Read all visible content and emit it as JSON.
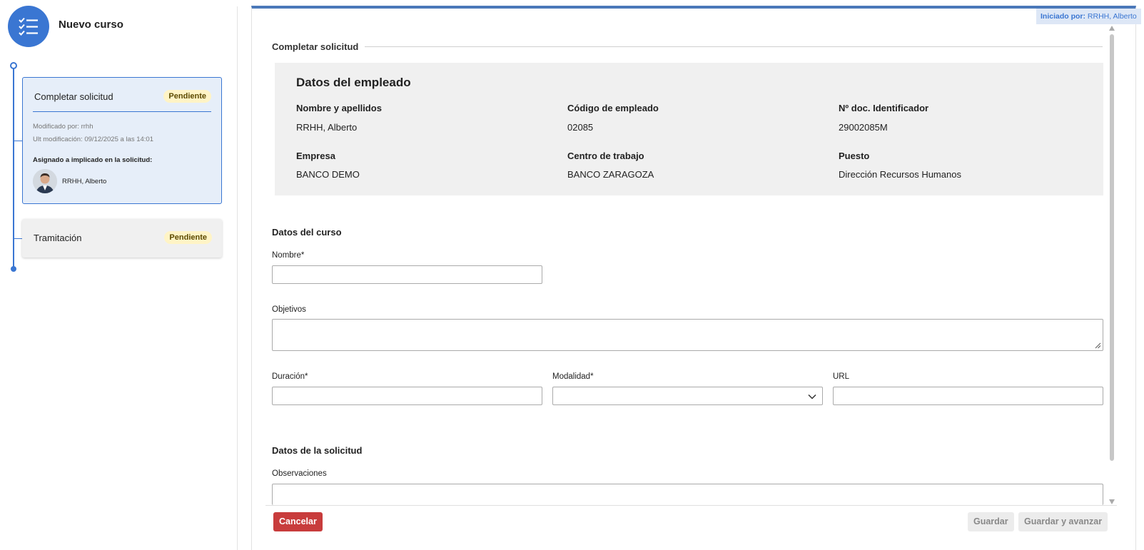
{
  "header": {
    "title": "Nuevo curso",
    "icon": "checklist-icon"
  },
  "steps": [
    {
      "title": "Completar solicitud",
      "status": "Pendiente",
      "modified_by": "Modificado por: rrhh",
      "last_modified": "Ult modificación: 09/12/2025 a las 14:01",
      "assigned_label": "Asignado a implicado en la solicitud:",
      "assignee": "RRHH, Alberto"
    },
    {
      "title": "Tramitación",
      "status": "Pendiente"
    }
  ],
  "initiated": {
    "label": "Iniciado por:",
    "value": "RRHH, Alberto"
  },
  "form": {
    "section_title": "Completar solicitud",
    "employee": {
      "title": "Datos del empleado",
      "fields": [
        {
          "label": "Nombre y apellidos",
          "value": "RRHH, Alberto"
        },
        {
          "label": "Código de empleado",
          "value": "02085"
        },
        {
          "label": "Nº doc. Identificador",
          "value": "29002085M"
        },
        {
          "label": "Empresa",
          "value": "BANCO DEMO"
        },
        {
          "label": "Centro de trabajo",
          "value": "BANCO ZARAGOZA"
        },
        {
          "label": "Puesto",
          "value": "Dirección Recursos Humanos"
        }
      ]
    },
    "course": {
      "title": "Datos del curso",
      "nombre_label": "Nombre*",
      "nombre_value": "",
      "objetivos_label": "Objetivos",
      "objetivos_value": "",
      "duracion_label": "Duración*",
      "duracion_value": "",
      "modalidad_label": "Modalidad*",
      "modalidad_value": "",
      "url_label": "URL",
      "url_value": ""
    },
    "request": {
      "title": "Datos de la solicitud",
      "observaciones_label": "Observaciones",
      "observaciones_value": ""
    }
  },
  "buttons": {
    "cancel": "Cancelar",
    "save": "Guardar",
    "save_advance": "Guardar y avanzar"
  },
  "colors": {
    "accent": "#3a76d2",
    "cancel": "#c83c3c",
    "badge_bg": "#fff4c6"
  }
}
